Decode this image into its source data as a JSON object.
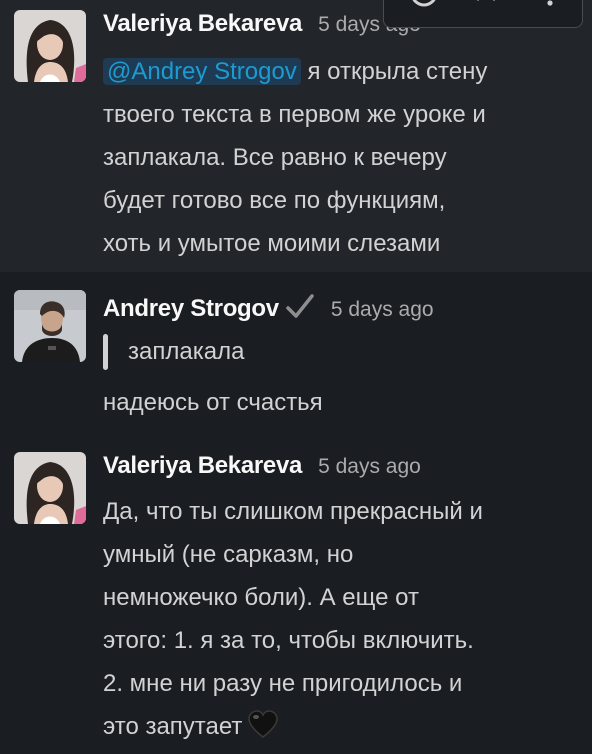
{
  "toolbar": {
    "items": [
      {
        "icon": "emoji-reaction-icon"
      },
      {
        "icon": "bookmark-icon"
      },
      {
        "icon": "more-icon"
      }
    ]
  },
  "messages": [
    {
      "author": "Valeriya Bekareva",
      "timestamp": "5 days ago",
      "mention": "@Andrey Strogov",
      "lines": [
        " я открыла стену",
        "твоего текста в первом же уроке и",
        "заплакала. Все равно к вечеру",
        "будет готово все по функциям,",
        "хоть и умытое моими слезами"
      ]
    },
    {
      "author": "Andrey Strogov",
      "verified_icon": "checkmark-icon",
      "timestamp": "5 days ago",
      "quote": "заплакала",
      "lines": [
        "надеюсь от счастья"
      ]
    },
    {
      "author": "Valeriya Bekareva",
      "timestamp": "5 days ago",
      "lines": [
        "Да, что ты слишком прекрасный и",
        "умный  (не сарказм, но",
        "немножечко боли). А еще от",
        "этого: 1. я за то, чтобы включить.",
        "2. мне ни разу не пригодилось и",
        "это запутает"
      ],
      "emoji": "black-heart"
    }
  ],
  "colors": {
    "background": "#1a1d21",
    "hover_background": "#222529",
    "text": "#d1d2d3",
    "author": "#f8f8f8",
    "timestamp": "#ababad",
    "mention_text": "#1d9bd1",
    "mention_bg": "#1f3b54"
  }
}
